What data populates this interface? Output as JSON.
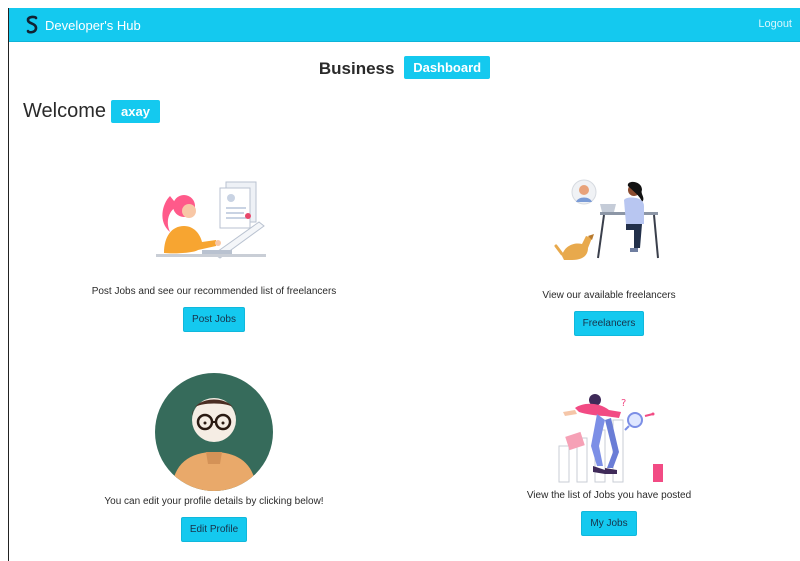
{
  "navbar": {
    "brand": "Developer's Hub",
    "logout": "Logout",
    "color": "#14c9ef"
  },
  "header": {
    "title": "Business",
    "badge": "Dashboard"
  },
  "welcome": {
    "label": "Welcome",
    "username": "axay"
  },
  "cards": [
    {
      "text": "Post Jobs and see our recommended list of freelancers",
      "button": "Post Jobs",
      "icon": "woman-at-laptop-illustration"
    },
    {
      "text": "View our available freelancers",
      "button": "Freelancers",
      "icon": "freelancer-with-dog-illustration"
    },
    {
      "text": "You can edit your profile details by clicking below!",
      "button": "Edit Profile",
      "icon": "profile-avatar-illustration"
    },
    {
      "text": "View the list of Jobs you have posted",
      "button": "My Jobs",
      "icon": "job-search-illustration"
    }
  ]
}
